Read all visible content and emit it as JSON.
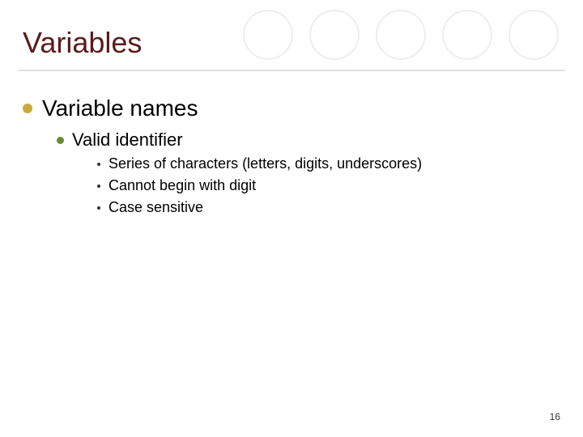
{
  "title": "Variables",
  "level1": {
    "text": "Variable names"
  },
  "level2": {
    "text": "Valid identifier"
  },
  "level3": [
    "Series of characters (letters, digits, underscores)",
    "Cannot begin with digit",
    "Case sensitive"
  ],
  "page_number": "16"
}
